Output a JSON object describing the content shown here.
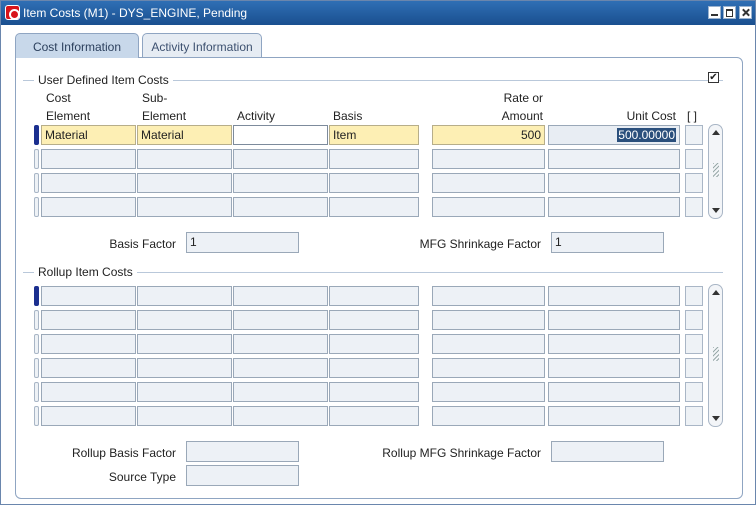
{
  "window": {
    "title": "Item Costs (M1) - DYS_ENGINE, Pending"
  },
  "tabs": [
    {
      "label": "Cost Information",
      "active": true
    },
    {
      "label": "Activity Information",
      "active": false
    }
  ],
  "user_defined": {
    "section_title": "User Defined Item Costs",
    "checked": true,
    "checkbox_mark": "✔",
    "headers": {
      "cost_element": [
        "Cost",
        "Element"
      ],
      "sub_element": [
        "Sub-",
        "Element"
      ],
      "activity": "Activity",
      "basis": "Basis",
      "rate_or_amount": [
        "Rate or",
        "Amount"
      ],
      "unit_cost": "Unit Cost",
      "flag": "[ ]"
    },
    "rows": [
      {
        "cost_element": "Material",
        "sub_element": "Material",
        "activity": "",
        "basis": "Item",
        "rate_or_amount": "500",
        "unit_cost": "500.00000"
      },
      {
        "cost_element": "",
        "sub_element": "",
        "activity": "",
        "basis": "",
        "rate_or_amount": "",
        "unit_cost": ""
      },
      {
        "cost_element": "",
        "sub_element": "",
        "activity": "",
        "basis": "",
        "rate_or_amount": "",
        "unit_cost": ""
      },
      {
        "cost_element": "",
        "sub_element": "",
        "activity": "",
        "basis": "",
        "rate_or_amount": "",
        "unit_cost": ""
      }
    ],
    "basis_factor_label": "Basis Factor",
    "basis_factor_value": "1",
    "mfg_shrinkage_label": "MFG Shrinkage Factor",
    "mfg_shrinkage_value": "1"
  },
  "rollup": {
    "section_title": "Rollup Item Costs",
    "rows": 6,
    "rollup_basis_factor_label": "Rollup Basis Factor",
    "rollup_basis_factor_value": "",
    "rollup_mfg_shrinkage_label": "Rollup MFG Shrinkage Factor",
    "rollup_mfg_shrinkage_value": "",
    "source_type_label": "Source Type",
    "source_type_value": ""
  },
  "colors": {
    "required_field": "#fdefb4",
    "title_bar": "#1a4f8f",
    "current_record": "#1b2f8f"
  }
}
